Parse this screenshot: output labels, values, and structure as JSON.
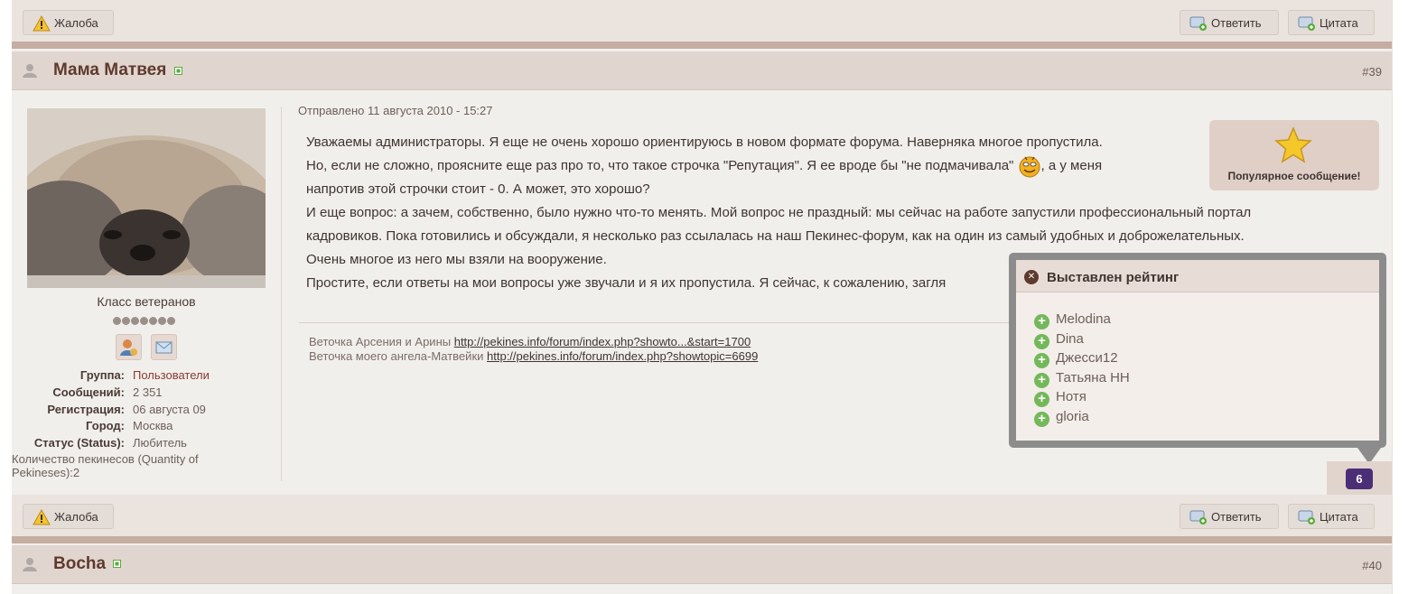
{
  "actions": {
    "report_label": "Жалоба",
    "reply_label": "Ответить",
    "quote_label": "Цитата"
  },
  "post": {
    "author": "Мама Матвея",
    "number": "#39",
    "date": "Отправлено 11 августа 2010 - 15:27",
    "paragraphs": [
      "Уважаемы администраторы. Я еще не очень хорошо ориентируюсь в новом формате форума. Наверняка многое пропустила.",
      "Но, если не сложно, проясните еще раз про то, что такое строчка \"Репутация\". Я ее вроде бы \"не подмачивала\"",
      ", а у меня",
      "напротив этой строчки стоит - 0. А может, это хорошо?",
      "И еще вопрос: а зачем, собственно, было нужно что-то менять. Мой вопрос не праздный: мы сейчас на работе запустили профессиональный портал",
      "кадровиков. Пока готовились и обсуждали, я несколько раз ссылалась на наш Пекинес-форум, как на один из самый удобных и доброжелательных.",
      "Очень многое из него мы взяли на вооружение.",
      "Простите, если ответы на мои вопросы уже звучали и я их пропустила. Я сейчас, к сожалению, загля"
    ],
    "popular_label": "Популярное сообщение!",
    "signature": [
      {
        "text": "Веточка Арсения и Арины",
        "link": "http://pekines.info/forum/index.php?showto...&start=1700"
      },
      {
        "text": "Веточка моего ангела-Матвейки",
        "link": "http://pekines.info/forum/index.php?showtopic=6699"
      }
    ],
    "reputation": "6"
  },
  "user": {
    "rank": "Класс ветеранов",
    "pips": 7,
    "info": [
      {
        "k": "Группа:",
        "v": "Пользователи"
      },
      {
        "k": "Сообщений:",
        "v": "2 351"
      },
      {
        "k": "Регистрация:",
        "v": "06 августа 09"
      },
      {
        "k": "Город:",
        "v": "Москва"
      },
      {
        "k": "Статус (Status):",
        "v": "Любитель"
      }
    ],
    "custom_field": "Количество пекинесов (Quantity of Pekineses):2"
  },
  "rating_popup": {
    "title": "Выставлен рейтинг",
    "users": [
      "Melodina",
      "Dina",
      "Джесси12",
      "Татьяна НН",
      "Нотя",
      "gloria"
    ]
  },
  "next_post": {
    "author": "Bocha",
    "number": "#40"
  },
  "colors": {
    "header_bg": "#e1d5cf",
    "separator": "#c5ada1",
    "author": "#5e3a2e",
    "group_link": "#8a3a2e",
    "rep_badge": "#4b2f76"
  }
}
